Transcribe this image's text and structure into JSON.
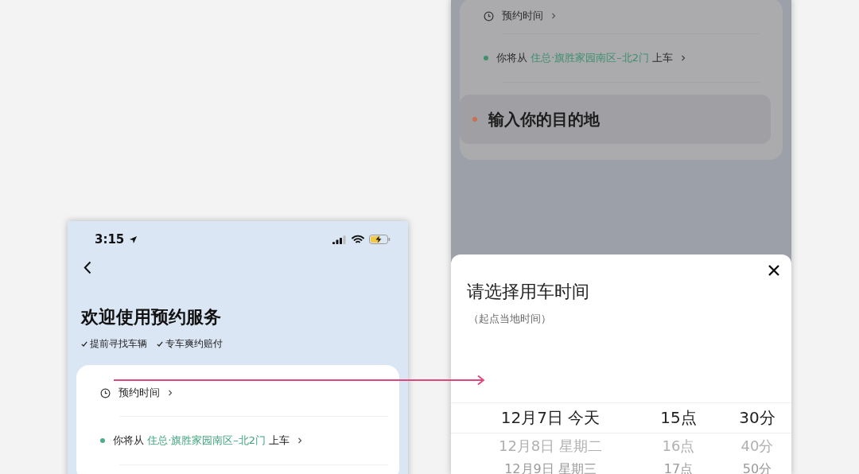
{
  "left_screen": {
    "status_bar": {
      "time": "3:15"
    },
    "title": "欢迎使用预约服务",
    "features": [
      "提前寻找车辆",
      "专车爽约赔付"
    ],
    "booking_time": {
      "label": "预约时间"
    },
    "pickup": {
      "prefix": "你将从",
      "place": "住总·旗胜家园南区–北2门",
      "suffix": "上车"
    }
  },
  "right_screen": {
    "booking_time": {
      "label": "预约时间"
    },
    "pickup": {
      "prefix": "你将从",
      "place": "住总·旗胜家园南区–北2门",
      "suffix": "上车"
    },
    "destination": {
      "placeholder": "输入你的目的地"
    },
    "sheet": {
      "title": "请选择用车时间",
      "subtitle": "（起点当地时间）",
      "columns": [
        {
          "items": [
            {
              "label": "12月7日 今天",
              "selected": true
            },
            {
              "label": "12月8日 星期二",
              "selected": false
            },
            {
              "label": "12月9日 星期三",
              "selected": false
            }
          ]
        },
        {
          "items": [
            {
              "label": "15点",
              "selected": true
            },
            {
              "label": "16点",
              "selected": false
            },
            {
              "label": "17点",
              "selected": false
            }
          ]
        },
        {
          "items": [
            {
              "label": "30分",
              "selected": true
            },
            {
              "label": "40分",
              "selected": false
            },
            {
              "label": "50分",
              "selected": false
            }
          ]
        }
      ]
    }
  }
}
